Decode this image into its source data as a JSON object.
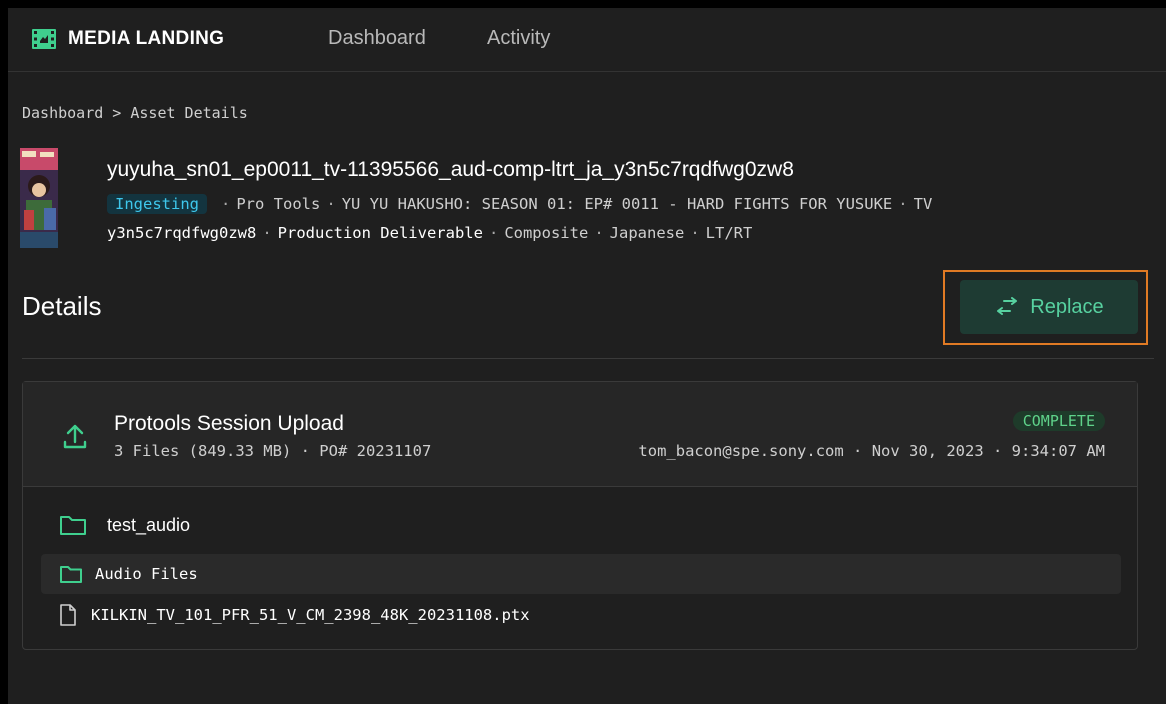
{
  "header": {
    "brand": "MEDIA LANDING",
    "tabs": [
      {
        "label": "Dashboard"
      },
      {
        "label": "Activity"
      }
    ]
  },
  "breadcrumb": "Dashboard > Asset Details",
  "asset": {
    "title": "yuyuha_sn01_ep0011_tv-11395566_aud-comp-ltrt_ja_y3n5c7rqdfwg0zw8",
    "status": "Ingesting",
    "meta_line1": [
      "Pro Tools",
      "YU YU HAKUSHO: SEASON 01: EP# 0011 - HARD FIGHTS FOR YUSUKE",
      "TV"
    ],
    "meta_line2": [
      "y3n5c7rqdfwg0zw8",
      "Production Deliverable",
      "Composite",
      "Japanese",
      "LT/RT"
    ]
  },
  "details": {
    "heading": "Details",
    "replace_label": "Replace"
  },
  "upload": {
    "title": "Protools Session Upload",
    "summary": "3 Files (849.33 MB) · PO# 20231107",
    "status": "COMPLETE",
    "uploader_line": "tom_bacon@spe.sony.com · Nov 30, 2023 · 9:34:07 AM"
  },
  "files": {
    "root_folder": "test_audio",
    "sub_folder": "Audio Files",
    "file_name": "KILKIN_TV_101_PFR_51_V_CM_2398_48K_20231108.ptx"
  },
  "colors": {
    "accent_green": "#57d1a0",
    "ingest_blue": "#3ec7ec",
    "highlight_orange": "#e07a24"
  },
  "icons": [
    "film-logo-icon",
    "swap-arrows-icon",
    "upload-icon",
    "folder-icon",
    "file-icon"
  ]
}
